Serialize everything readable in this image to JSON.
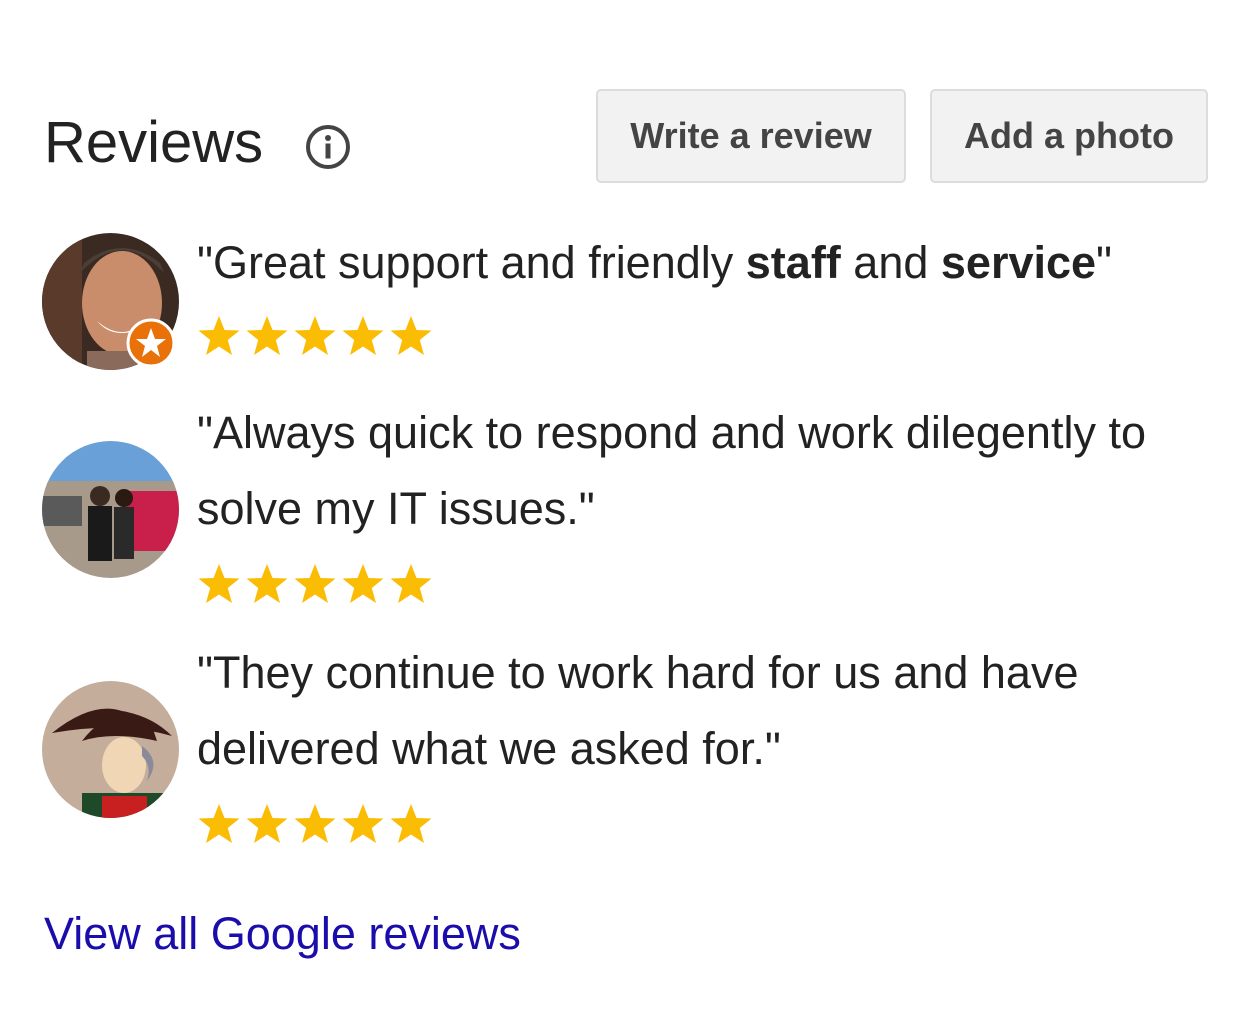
{
  "header": {
    "title": "Reviews",
    "info_icon": "info-circle-icon",
    "write_review_label": "Write a review",
    "add_photo_label": "Add a photo"
  },
  "reviews": [
    {
      "quote_parts": [
        "\"Great support and friendly ",
        "staff",
        " and ",
        "service",
        "\""
      ],
      "rating": 5,
      "avatar": "user-avatar-smiling-man",
      "badge": "local-guide-star-icon"
    },
    {
      "quote": "\"Always quick to respond and work dilegently to solve my IT issues.\"",
      "rating": 5,
      "avatar": "user-avatar-couple-outdoors"
    },
    {
      "quote": "\"They continue to work hard for us and have delivered what we asked for.\"",
      "rating": 5,
      "avatar": "user-avatar-cartoon-napoleon"
    }
  ],
  "footer": {
    "view_all_label": "View all Google reviews"
  },
  "colors": {
    "star": "#fbbc04",
    "link": "#1a0dab",
    "badge": "#e8710a",
    "button_bg": "#f2f2f2",
    "button_text": "#444444"
  }
}
